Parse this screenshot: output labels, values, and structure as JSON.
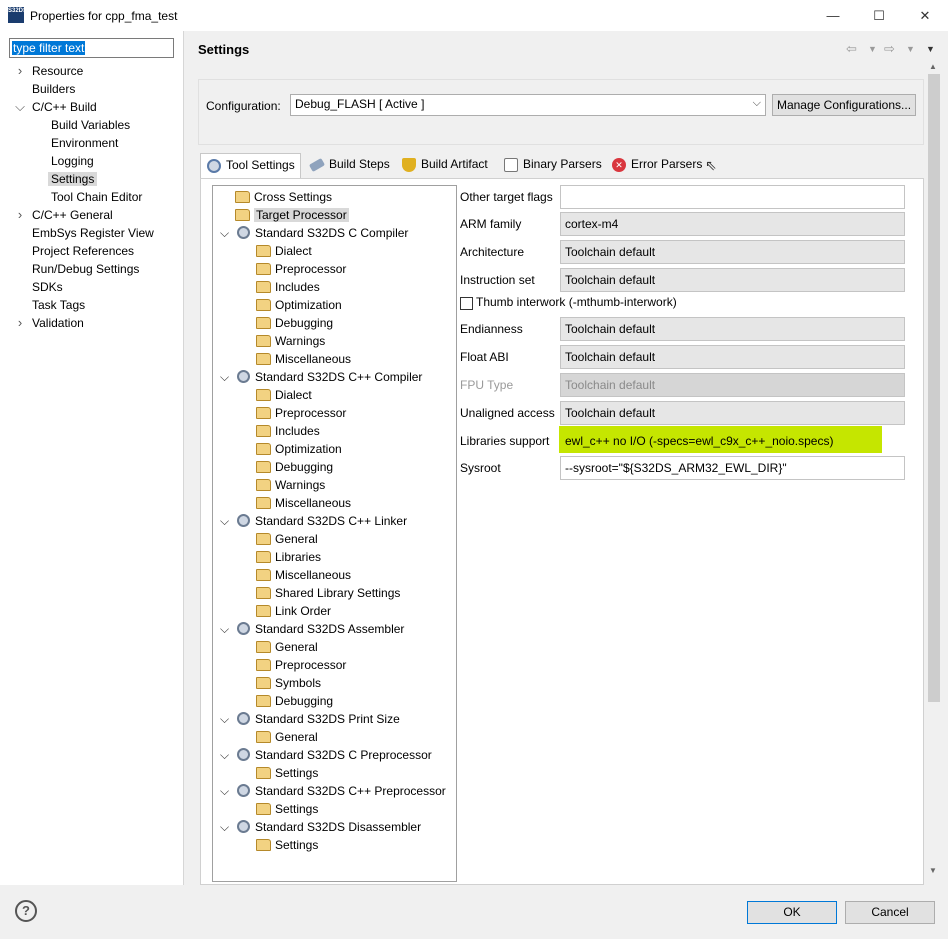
{
  "window": {
    "app_icon": "S32DS",
    "title": "Properties for cpp_fma_test"
  },
  "left": {
    "filter_placeholder": "type filter text",
    "items": [
      {
        "label": "Resource",
        "arrow": ">",
        "indent": 1
      },
      {
        "label": "Builders",
        "arrow": "",
        "indent": 1
      },
      {
        "label": "C/C++ Build",
        "arrow": "v",
        "indent": 1
      },
      {
        "label": "Build Variables",
        "arrow": "",
        "indent": 2
      },
      {
        "label": "Environment",
        "arrow": "",
        "indent": 2
      },
      {
        "label": "Logging",
        "arrow": "",
        "indent": 2
      },
      {
        "label": "Settings",
        "arrow": "",
        "indent": 2,
        "selected": true
      },
      {
        "label": "Tool Chain Editor",
        "arrow": "",
        "indent": 2
      },
      {
        "label": "C/C++ General",
        "arrow": ">",
        "indent": 1
      },
      {
        "label": "EmbSys Register View",
        "arrow": "",
        "indent": 1
      },
      {
        "label": "Project References",
        "arrow": "",
        "indent": 1
      },
      {
        "label": "Run/Debug Settings",
        "arrow": "",
        "indent": 1
      },
      {
        "label": "SDKs",
        "arrow": "",
        "indent": 1
      },
      {
        "label": "Task Tags",
        "arrow": "",
        "indent": 1
      },
      {
        "label": "Validation",
        "arrow": ">",
        "indent": 1
      }
    ]
  },
  "header": {
    "title": "Settings"
  },
  "config": {
    "label": "Configuration:",
    "value": "Debug_FLASH  [ Active ]",
    "manage_label": "Manage Configurations..."
  },
  "tabs": [
    {
      "label": "Tool Settings",
      "icon": "tool-settings-icon",
      "color": "#5a7aa8"
    },
    {
      "label": "Build Steps",
      "icon": "build-steps-icon",
      "color": "#7a8fa8"
    },
    {
      "label": "Build Artifact",
      "icon": "trophy-icon",
      "color": "#e0b020"
    },
    {
      "label": "Binary Parsers",
      "icon": "binary-file-icon",
      "color": "#8a8a8a"
    },
    {
      "label": "Error Parsers",
      "icon": "error-icon",
      "color": "#d9363e"
    }
  ],
  "tree": [
    {
      "label": "Cross Settings",
      "level": 1,
      "type": "folder",
      "toggle": ""
    },
    {
      "label": "Target Processor",
      "level": 1,
      "type": "folder",
      "toggle": "",
      "selected": true
    },
    {
      "label": "Standard S32DS C Compiler",
      "level": 1,
      "type": "tool",
      "toggle": "v"
    },
    {
      "label": "Dialect",
      "level": 2,
      "type": "folder"
    },
    {
      "label": "Preprocessor",
      "level": 2,
      "type": "folder"
    },
    {
      "label": "Includes",
      "level": 2,
      "type": "folder"
    },
    {
      "label": "Optimization",
      "level": 2,
      "type": "folder"
    },
    {
      "label": "Debugging",
      "level": 2,
      "type": "folder"
    },
    {
      "label": "Warnings",
      "level": 2,
      "type": "folder"
    },
    {
      "label": "Miscellaneous",
      "level": 2,
      "type": "folder"
    },
    {
      "label": "Standard S32DS C++ Compiler",
      "level": 1,
      "type": "tool",
      "toggle": "v"
    },
    {
      "label": "Dialect",
      "level": 2,
      "type": "folder"
    },
    {
      "label": "Preprocessor",
      "level": 2,
      "type": "folder"
    },
    {
      "label": "Includes",
      "level": 2,
      "type": "folder"
    },
    {
      "label": "Optimization",
      "level": 2,
      "type": "folder"
    },
    {
      "label": "Debugging",
      "level": 2,
      "type": "folder"
    },
    {
      "label": "Warnings",
      "level": 2,
      "type": "folder"
    },
    {
      "label": "Miscellaneous",
      "level": 2,
      "type": "folder"
    },
    {
      "label": "Standard S32DS C++ Linker",
      "level": 1,
      "type": "tool",
      "toggle": "v"
    },
    {
      "label": "General",
      "level": 2,
      "type": "folder"
    },
    {
      "label": "Libraries",
      "level": 2,
      "type": "folder"
    },
    {
      "label": "Miscellaneous",
      "level": 2,
      "type": "folder"
    },
    {
      "label": "Shared Library Settings",
      "level": 2,
      "type": "folder"
    },
    {
      "label": "Link Order",
      "level": 2,
      "type": "folder"
    },
    {
      "label": "Standard S32DS Assembler",
      "level": 1,
      "type": "tool",
      "toggle": "v"
    },
    {
      "label": "General",
      "level": 2,
      "type": "folder"
    },
    {
      "label": "Preprocessor",
      "level": 2,
      "type": "folder"
    },
    {
      "label": "Symbols",
      "level": 2,
      "type": "folder"
    },
    {
      "label": "Debugging",
      "level": 2,
      "type": "folder"
    },
    {
      "label": "Standard S32DS Print Size",
      "level": 1,
      "type": "tool",
      "toggle": "v"
    },
    {
      "label": "General",
      "level": 2,
      "type": "folder"
    },
    {
      "label": "Standard S32DS C Preprocessor",
      "level": 1,
      "type": "tool",
      "toggle": "v"
    },
    {
      "label": "Settings",
      "level": 2,
      "type": "folder"
    },
    {
      "label": "Standard S32DS C++ Preprocessor",
      "level": 1,
      "type": "tool",
      "toggle": "v"
    },
    {
      "label": "Settings",
      "level": 2,
      "type": "folder"
    },
    {
      "label": "Standard S32DS Disassembler",
      "level": 1,
      "type": "tool",
      "toggle": "v"
    },
    {
      "label": "Settings",
      "level": 2,
      "type": "folder"
    }
  ],
  "form": {
    "other_flags": {
      "label": "Other target flags",
      "value": ""
    },
    "arm_family": {
      "label": "ARM family",
      "value": "cortex-m4"
    },
    "architecture": {
      "label": "Architecture",
      "value": "Toolchain default"
    },
    "instruction_set": {
      "label": "Instruction set",
      "value": "Toolchain default"
    },
    "thumb_interwork": {
      "label": "Thumb interwork (-mthumb-interwork)",
      "checked": false
    },
    "endianness": {
      "label": "Endianness",
      "value": "Toolchain default"
    },
    "float_abi": {
      "label": "Float ABI",
      "value": "Toolchain default"
    },
    "fpu_type": {
      "label": "FPU Type",
      "value": "Toolchain default",
      "disabled": true
    },
    "unaligned_access": {
      "label": "Unaligned access",
      "value": "Toolchain default"
    },
    "libraries_support": {
      "label": "Libraries support",
      "value": "ewl_c++ no I/O (-specs=ewl_c9x_c++_noio.specs)",
      "highlight": "#c5e600"
    },
    "sysroot": {
      "label": "Sysroot",
      "value": "--sysroot=\"${S32DS_ARM32_EWL_DIR}\""
    }
  },
  "footer": {
    "help": "?",
    "ok_label": "OK",
    "cancel_label": "Cancel"
  }
}
